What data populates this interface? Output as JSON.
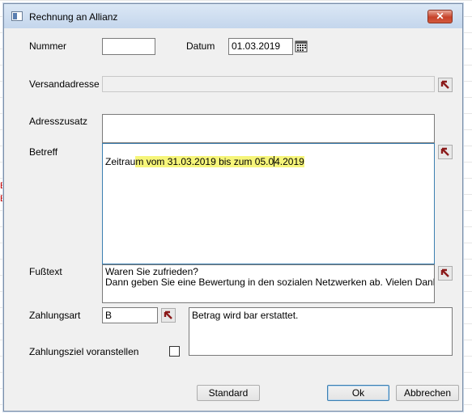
{
  "window": {
    "title": "Rechnung an Allianz",
    "close_glyph": "✕"
  },
  "fields": {
    "nummer": {
      "label": "Nummer",
      "value": ""
    },
    "datum": {
      "label": "Datum",
      "value": "01.03.2019"
    },
    "versandadresse": {
      "label": "Versandadresse",
      "value": ""
    },
    "adresszusatz": {
      "label": "Adresszusatz",
      "value": ""
    },
    "betreff": {
      "label": "Betreff",
      "value_before": "Zeitrau",
      "value_highlight_1": "m vom 31.03.2019 bis zum 05.0",
      "value_highlight_2": "4.2019"
    },
    "fusstext": {
      "label": "Fußtext",
      "value": "Waren Sie zufrieden?\nDann geben Sie eine Bewertung in den sozialen Netzwerken ab. Vielen Dank."
    },
    "zahlungsart": {
      "label": "Zahlungsart",
      "value": "B",
      "description": "Betrag wird bar erstattet."
    },
    "zahlungsziel": {
      "label": "Zahlungsziel voranstellen",
      "checked": false
    }
  },
  "buttons": {
    "standard": "Standard",
    "ok": "Ok",
    "abbrechen": "Abbrechen"
  },
  "icons": {
    "calendar": "calendar-icon",
    "arrow": "arrow-up-left-icon"
  },
  "colors": {
    "arrow": "#8b1a1a",
    "highlight": "#f6f57a",
    "close": "#c7432a"
  }
}
